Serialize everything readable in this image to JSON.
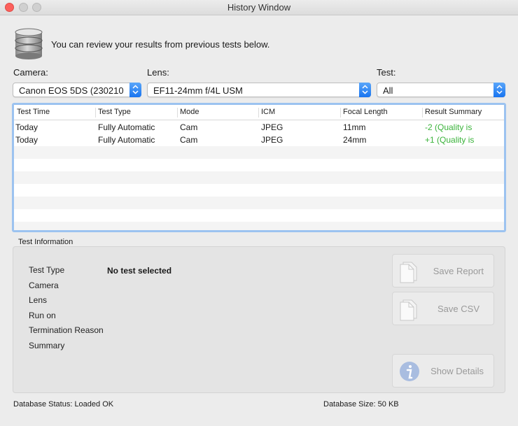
{
  "window": {
    "title": "History Window"
  },
  "intro": {
    "text": "You can review your results from previous tests below."
  },
  "filters": {
    "camera_label": "Camera:",
    "camera_value": "Canon EOS 5DS (230210...",
    "lens_label": "Lens:",
    "lens_value": "EF11-24mm f/4L USM",
    "test_label": "Test:",
    "test_value": "All"
  },
  "table": {
    "columns": [
      "Test Time",
      "Test Type",
      "Mode",
      "ICM",
      "Focal Length",
      "Result Summary"
    ],
    "rows": [
      {
        "time": "Today",
        "type": "Fully Automatic",
        "mode": "Cam",
        "icm": "JPEG",
        "focal": "11mm",
        "summary": "-2 (Quality is"
      },
      {
        "time": "Today",
        "type": "Fully Automatic",
        "mode": "Cam",
        "icm": "JPEG",
        "focal": "24mm",
        "summary": "+1 (Quality is"
      }
    ]
  },
  "info": {
    "group_title": "Test Information",
    "labels": [
      "Test Type",
      "Camera",
      "Lens",
      "Run on",
      "Termination Reason",
      "Summary"
    ],
    "test_type_value": "No test selected"
  },
  "buttons": {
    "save_report": "Save Report",
    "save_csv": "Save CSV",
    "show_details": "Show Details"
  },
  "status": {
    "db_status": "Database Status: Loaded OK",
    "db_size": "Database Size: 50 KB"
  },
  "colors": {
    "accent": "#1874f0",
    "positive": "#3bb33b",
    "close": "#fc605c"
  }
}
